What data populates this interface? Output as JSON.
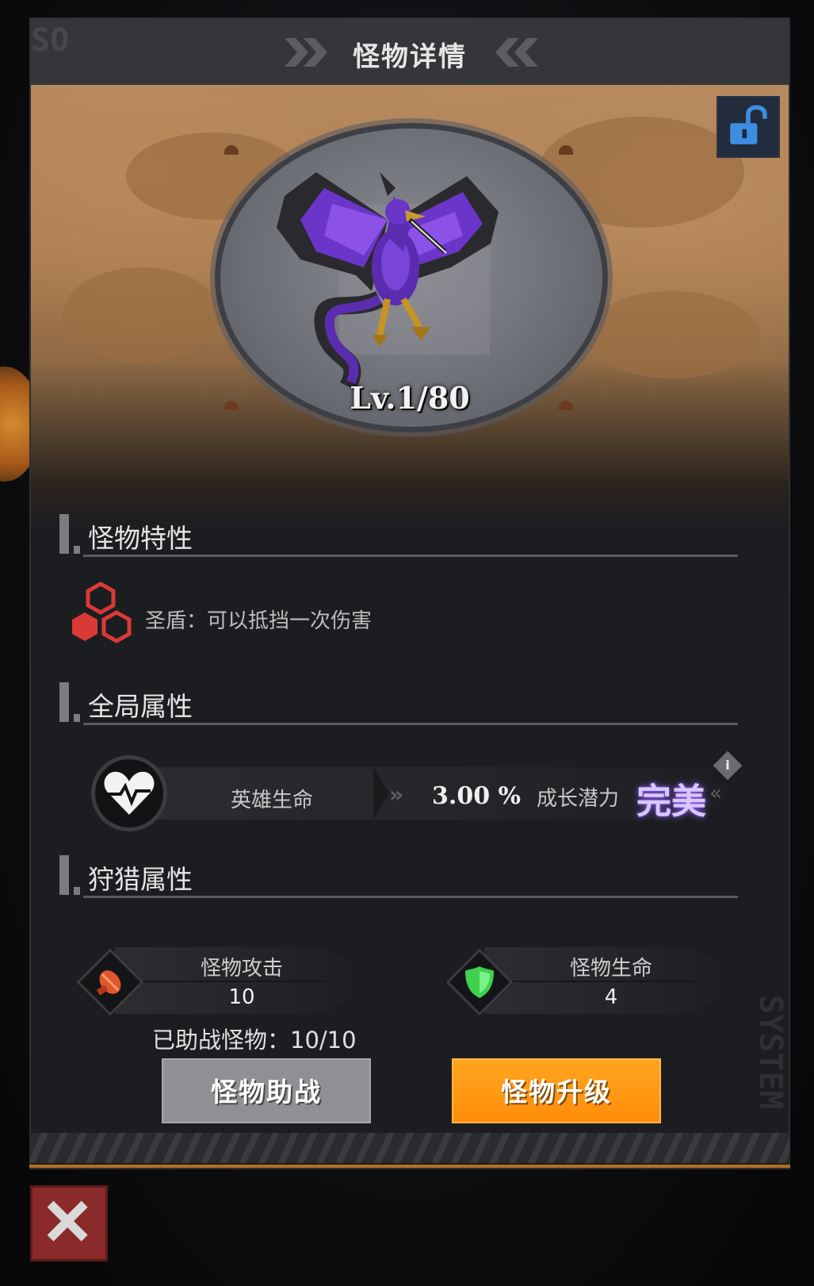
{
  "dialog": {
    "title": "怪物详情",
    "corner_text": "SO",
    "side_text": "SYSTEM"
  },
  "monster": {
    "level": "Lv.1/80",
    "lock_state": "unlocked"
  },
  "sections": {
    "traits": "怪物特性",
    "global": "全局属性",
    "hunting": "狩猎属性"
  },
  "trait": {
    "icon": "honeycomb-icon",
    "text": "圣盾：可以抵挡一次伤害"
  },
  "global_attr": {
    "icon": "heart-pulse-icon",
    "label": "英雄生命",
    "arrows": "»",
    "value": "3.00 %",
    "growth_label": "成长潜力",
    "growth_value": "完美",
    "growth_tail": "«",
    "info": "i"
  },
  "hunting_stats": [
    {
      "icon": "fist-icon",
      "name": "怪物攻击",
      "value": "10",
      "color": "#e0562f"
    },
    {
      "icon": "green-shield-icon",
      "name": "怪物生命",
      "value": "4",
      "color": "#3fd04f"
    }
  ],
  "assist": {
    "text": "已助战怪物：10/10"
  },
  "buttons": {
    "assist": "怪物助战",
    "upgrade": "怪物升级"
  },
  "colors": {
    "accent_orange": "#ff9a14",
    "button_grey": "#8f9093",
    "growth_purple": "#8e5bff",
    "trait_red": "#d93a36"
  }
}
